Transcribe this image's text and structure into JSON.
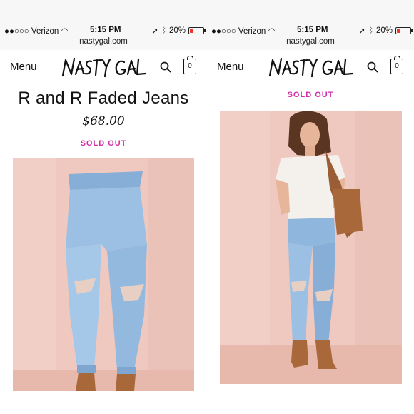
{
  "status_bar": {
    "carrier": "●●○○○ Verizon",
    "time": "5:15 PM",
    "battery": "20%",
    "url": "nastygal.com"
  },
  "nav": {
    "menu_label": "Menu",
    "logo_text": "NASTY GAL",
    "bag_count": "0"
  },
  "product": {
    "title": "R and R Faded Jeans",
    "price": "$68.00",
    "status": "SOLD OUT"
  },
  "colors": {
    "sold_out": "#d12ea8",
    "backdrop": "#efc8bf",
    "denim": "#8fb6dc"
  },
  "icons": [
    "wifi-icon",
    "location-icon",
    "bluetooth-icon",
    "battery-icon",
    "search-icon",
    "shopping-bag-icon"
  ]
}
